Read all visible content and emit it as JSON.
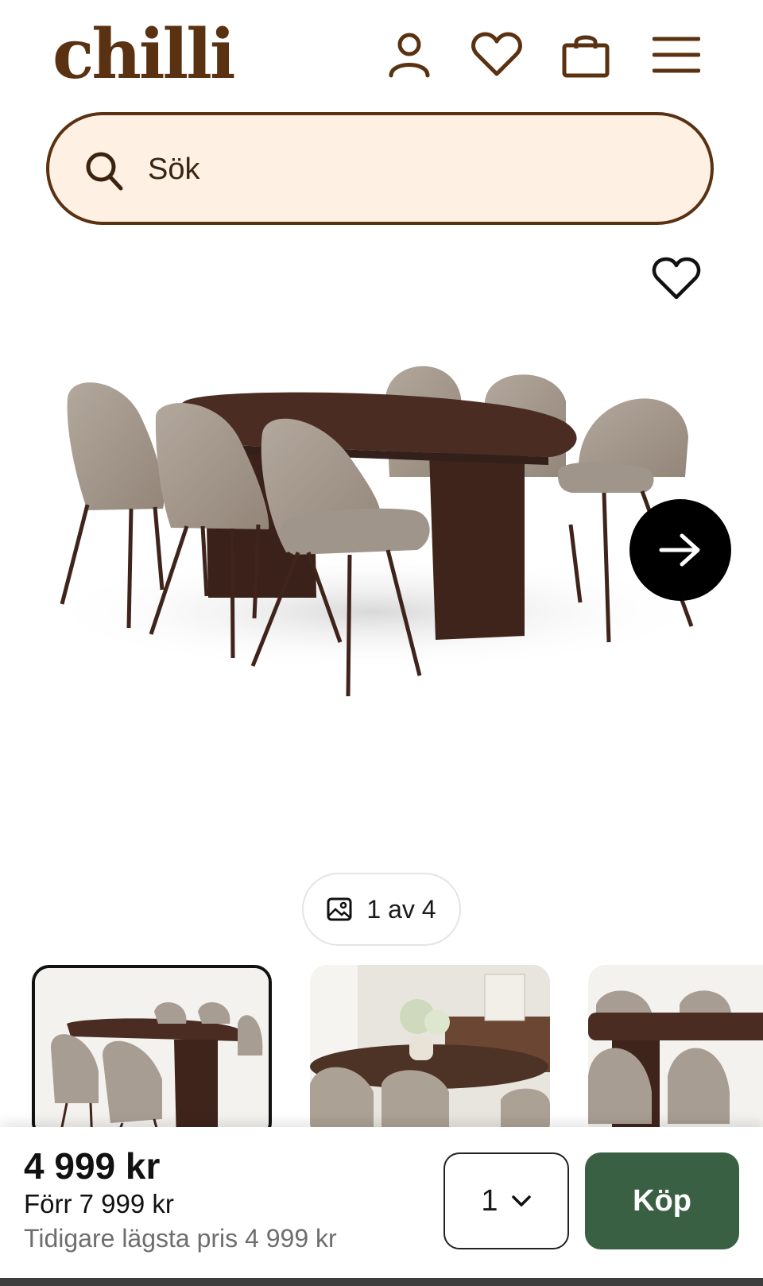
{
  "header": {
    "logo": "chilli",
    "icons": [
      "user-icon",
      "heart-icon",
      "bag-icon",
      "menu-icon"
    ]
  },
  "search": {
    "placeholder": "Sök"
  },
  "gallery": {
    "counter": "1 av 4",
    "current": 1,
    "total": 4,
    "thumbnail_count": 3
  },
  "purchase": {
    "price": "4 999 kr",
    "was_price": "Förr 7 999 kr",
    "lowest_price": "Tidigare lägsta pris 4 999 kr",
    "quantity": "1",
    "buy_label": "Köp"
  },
  "colors": {
    "brand": "#5a3211",
    "search_bg": "#fef0e3",
    "buy_button": "#3a6043",
    "wood": "#4a2c22",
    "fabric": "#a2968b"
  }
}
